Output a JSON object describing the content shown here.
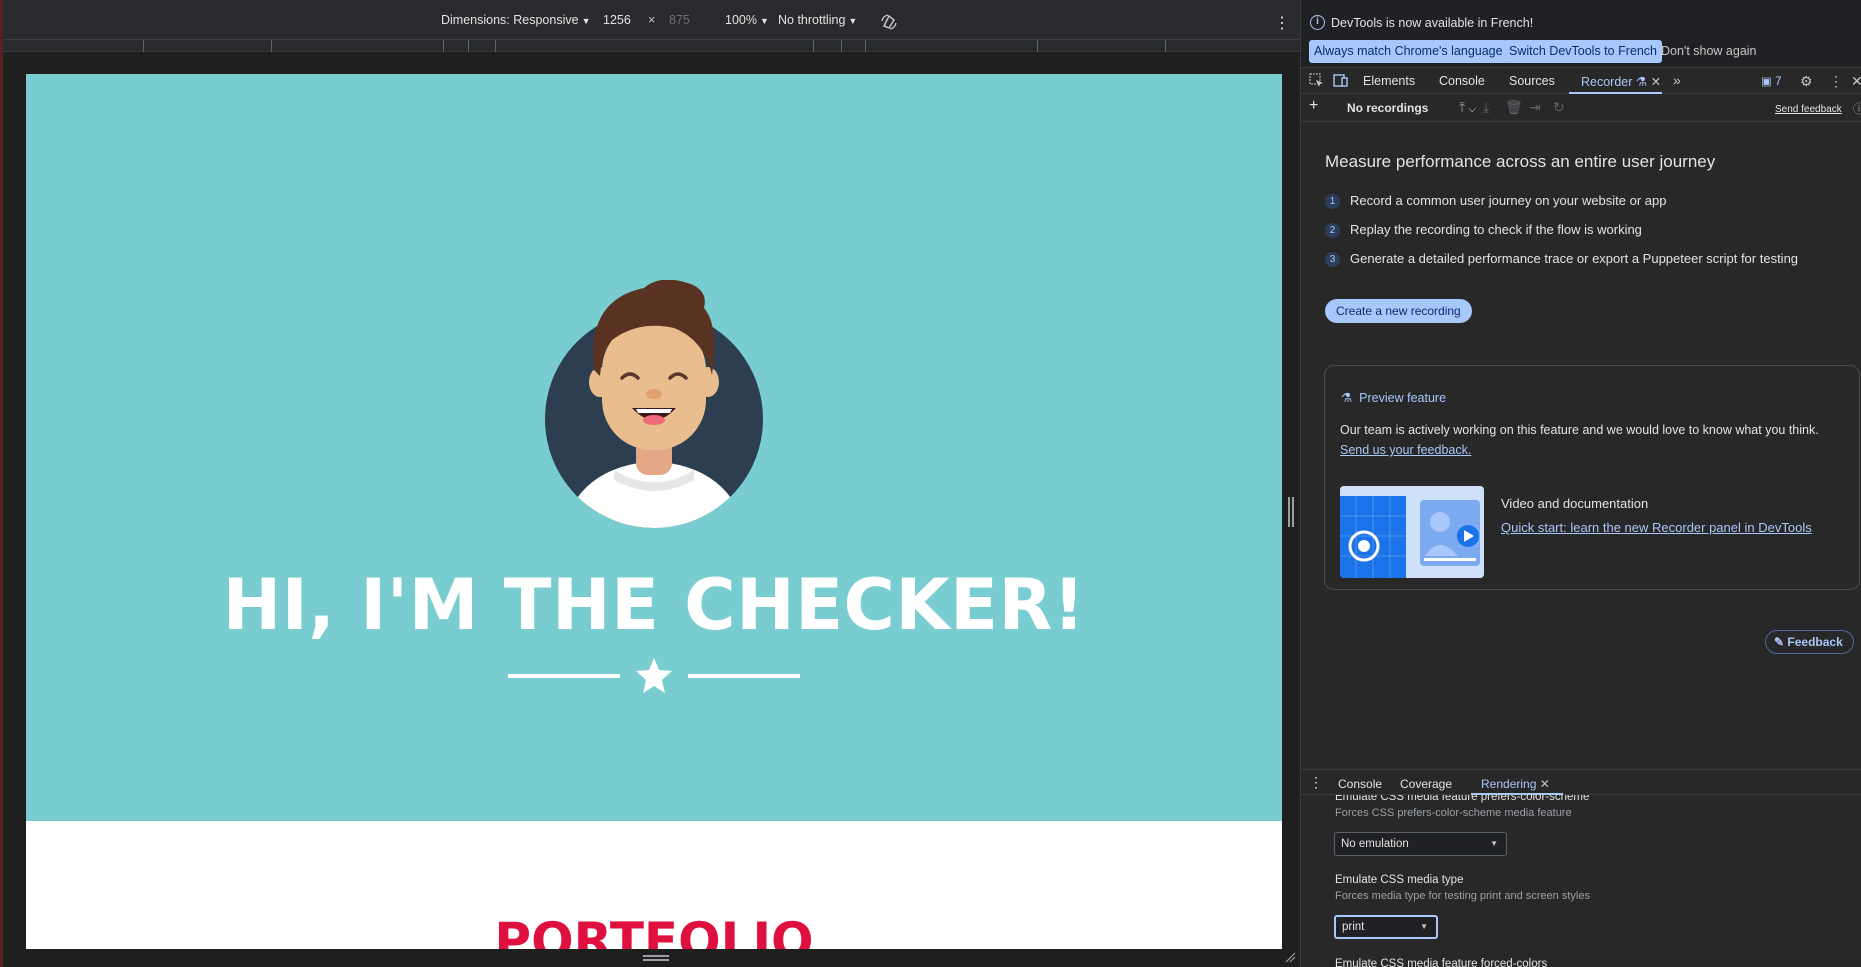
{
  "device_toolbar": {
    "dimensions_label": "Dimensions: Responsive",
    "width": "1256",
    "times": "×",
    "height": "875",
    "zoom": "100%",
    "throttling": "No throttling",
    "rotate_icon": "rotate-icon",
    "more_icon": "more-vert-icon"
  },
  "page": {
    "hero_bg": "#79cdd1",
    "title": "HI, I'M THE CHECKER!",
    "portfolio_heading": "PORTFOLIO",
    "portfolio_color": "#e0103e"
  },
  "infobar": {
    "message": "DevTools is now available in French!",
    "btn_match": "Always match Chrome's language",
    "btn_switch": "Switch DevTools to French",
    "btn_dismiss": "Don't show again"
  },
  "tabs": {
    "elements": "Elements",
    "console": "Console",
    "sources": "Sources",
    "recorder": "Recorder",
    "issues_count": "7"
  },
  "recorder_toolbar": {
    "recordings_select": "No recordings",
    "send_feedback": "Send feedback"
  },
  "recorder": {
    "title": "Measure performance across an entire user journey",
    "steps": [
      {
        "num": "1",
        "text": "Record a common user journey on your website or app"
      },
      {
        "num": "2",
        "text": "Replay the recording to check if the flow is working"
      },
      {
        "num": "3",
        "text": "Generate a detailed performance trace or export a Puppeteer script for testing"
      }
    ],
    "create_button": "Create a new recording",
    "preview_heading": "Preview feature",
    "preview_text": "Our team is actively working on this feature and we would love to know what you think.",
    "preview_link": "Send us your feedback.",
    "video_title": "Video and documentation",
    "video_link": "Quick start: learn the new Recorder panel in DevTools",
    "feedback_button": "Feedback"
  },
  "drawer": {
    "tab_console": "Console",
    "tab_coverage": "Coverage",
    "tab_rendering": "Rendering",
    "items": [
      {
        "title": "Emulate CSS media feature prefers-color-scheme",
        "subtitle": "Forces CSS prefers-color-scheme media feature",
        "value": "No emulation"
      },
      {
        "title": "Emulate CSS media type",
        "subtitle": "Forces media type for testing print and screen styles",
        "value": "print"
      },
      {
        "title": "Emulate CSS media feature forced-colors"
      }
    ]
  },
  "colors": {
    "accent": "#a8c7fa",
    "panel_bg": "#282828"
  }
}
